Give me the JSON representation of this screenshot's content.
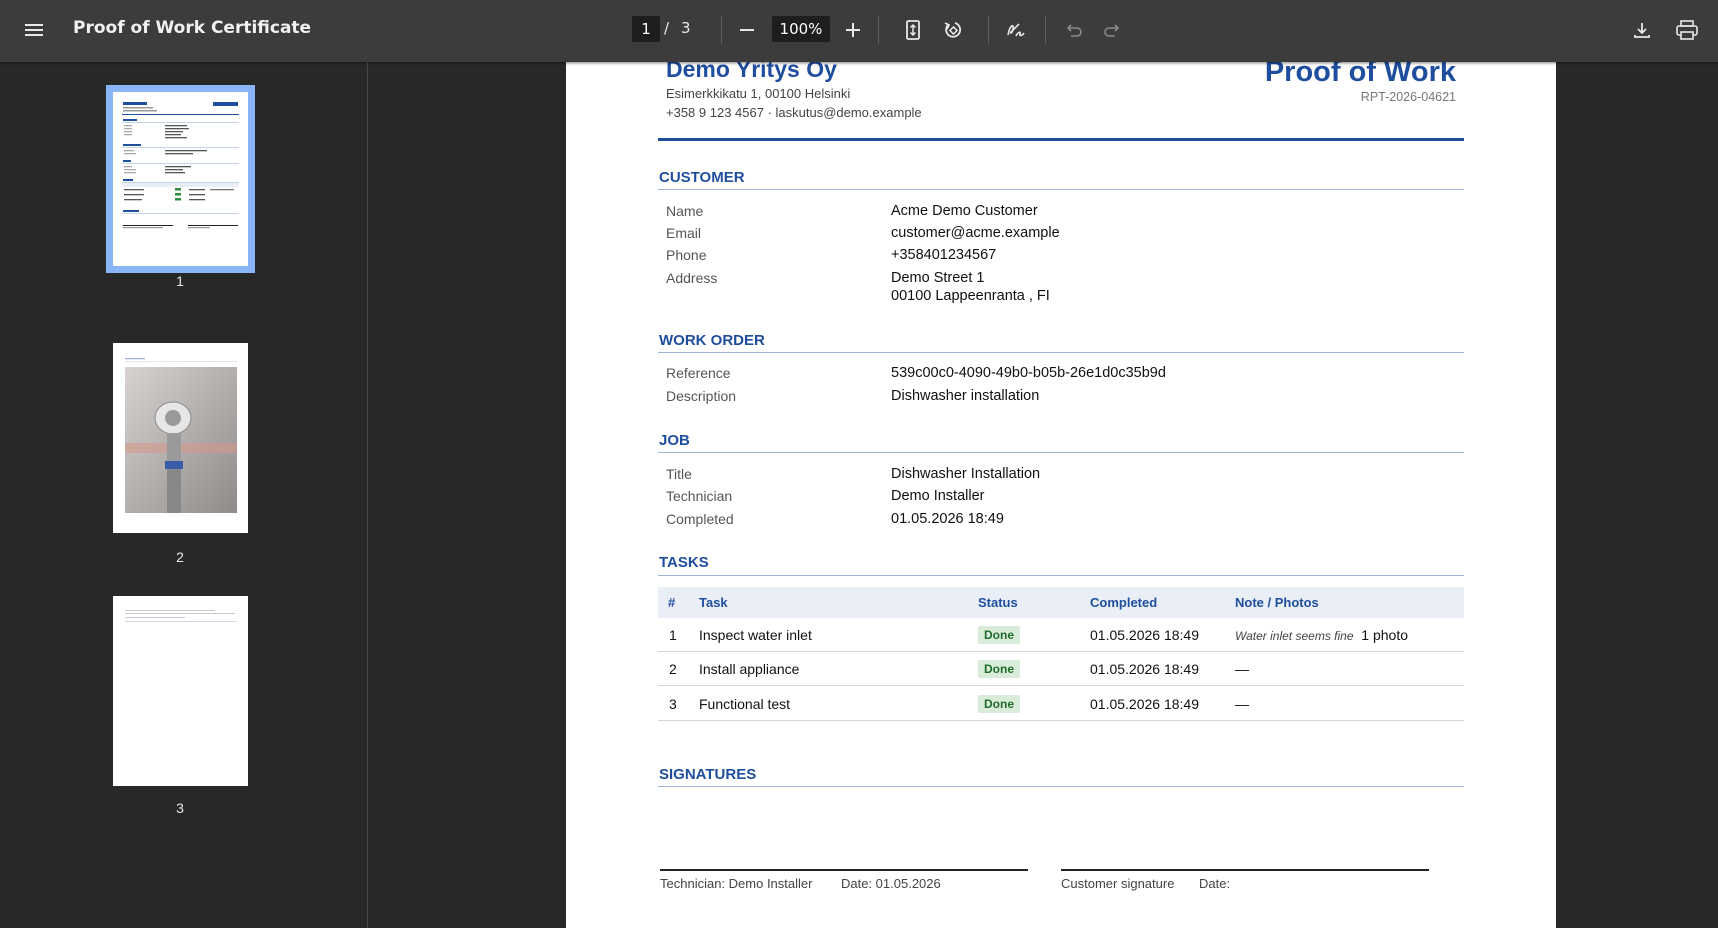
{
  "toolbar": {
    "title": "Proof of Work Certificate",
    "page_current": "1",
    "page_separator": "/",
    "page_total": "3",
    "zoom": "100%"
  },
  "sidebar": {
    "thumbnails": [
      {
        "label": "1"
      },
      {
        "label": "2"
      },
      {
        "label": "3"
      }
    ]
  },
  "document": {
    "company_name": "Demo Yritys Oy",
    "company_address": "Esimerkkikatu 1, 00100 Helsinki",
    "company_contact": "+358 9 123 4567  ·  laskutus@demo.example",
    "title": "Proof of Work",
    "reference_code": "RPT-2026-04621",
    "customer": {
      "heading": "CUSTOMER",
      "name_label": "Name",
      "name": "Acme Demo Customer",
      "email_label": "Email",
      "email": "customer@acme.example",
      "phone_label": "Phone",
      "phone": "+358401234567",
      "address_label": "Address",
      "address_line1": "Demo Street 1",
      "address_line2": "00100 Lappeenranta , FI"
    },
    "work_order": {
      "heading": "WORK ORDER",
      "reference_label": "Reference",
      "reference": "539c00c0-4090-49b0-b05b-26e1d0c35b9d",
      "description_label": "Description",
      "description": "Dishwasher installation"
    },
    "job": {
      "heading": "JOB",
      "title_label": "Title",
      "title": "Dishwasher Installation",
      "technician_label": "Technician",
      "technician": "Demo Installer",
      "completed_label": "Completed",
      "completed": "01.05.2026 18:49"
    },
    "tasks": {
      "heading": "TASKS",
      "columns": {
        "num": "#",
        "task": "Task",
        "status": "Status",
        "completed": "Completed",
        "note": "Note / Photos"
      },
      "rows": [
        {
          "num": "1",
          "task": "Inspect water inlet",
          "status": "Done",
          "completed": "01.05.2026 18:49",
          "note_italic": "Water inlet seems fine",
          "note": "1 photo"
        },
        {
          "num": "2",
          "task": "Install appliance",
          "status": "Done",
          "completed": "01.05.2026 18:49",
          "note_italic": "",
          "note": "—"
        },
        {
          "num": "3",
          "task": "Functional test",
          "status": "Done",
          "completed": "01.05.2026 18:49",
          "note_italic": "",
          "note": "—"
        }
      ]
    },
    "signatures": {
      "heading": "SIGNATURES",
      "technician_label": "Technician: Demo Installer",
      "technician_date": "Date: 01.05.2026",
      "customer_label": "Customer signature",
      "customer_date": "Date:"
    }
  }
}
